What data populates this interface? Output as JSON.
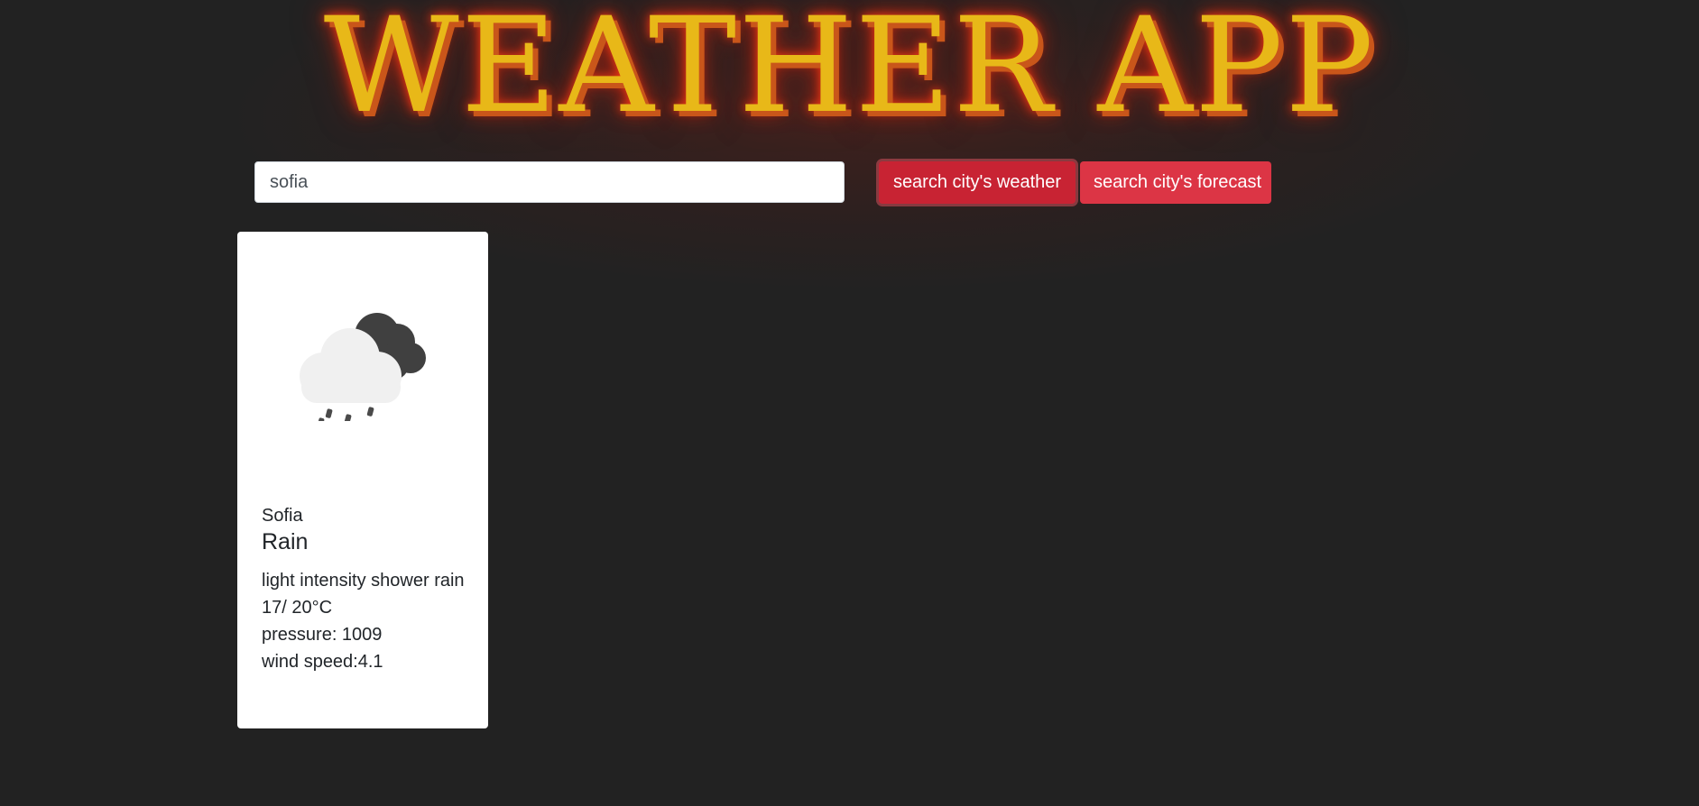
{
  "header": {
    "title": "WEATHER APP"
  },
  "search": {
    "value": "sofia",
    "placeholder": ""
  },
  "buttons": {
    "weather_label": "search city's weather",
    "forecast_label": "search city's forecast"
  },
  "colors": {
    "background": "#222222",
    "title": "#e8b818",
    "title_glow": "#ff3c14",
    "button": "#dc3545",
    "card": "#ffffff"
  },
  "weather_card": {
    "icon": "rain-cloud-icon",
    "city": "Sofia",
    "main": "Rain",
    "description": "light intensity shower rain",
    "temperature": "17/ 20°C",
    "pressure": "pressure: 1009",
    "wind": "wind speed:4.1"
  }
}
